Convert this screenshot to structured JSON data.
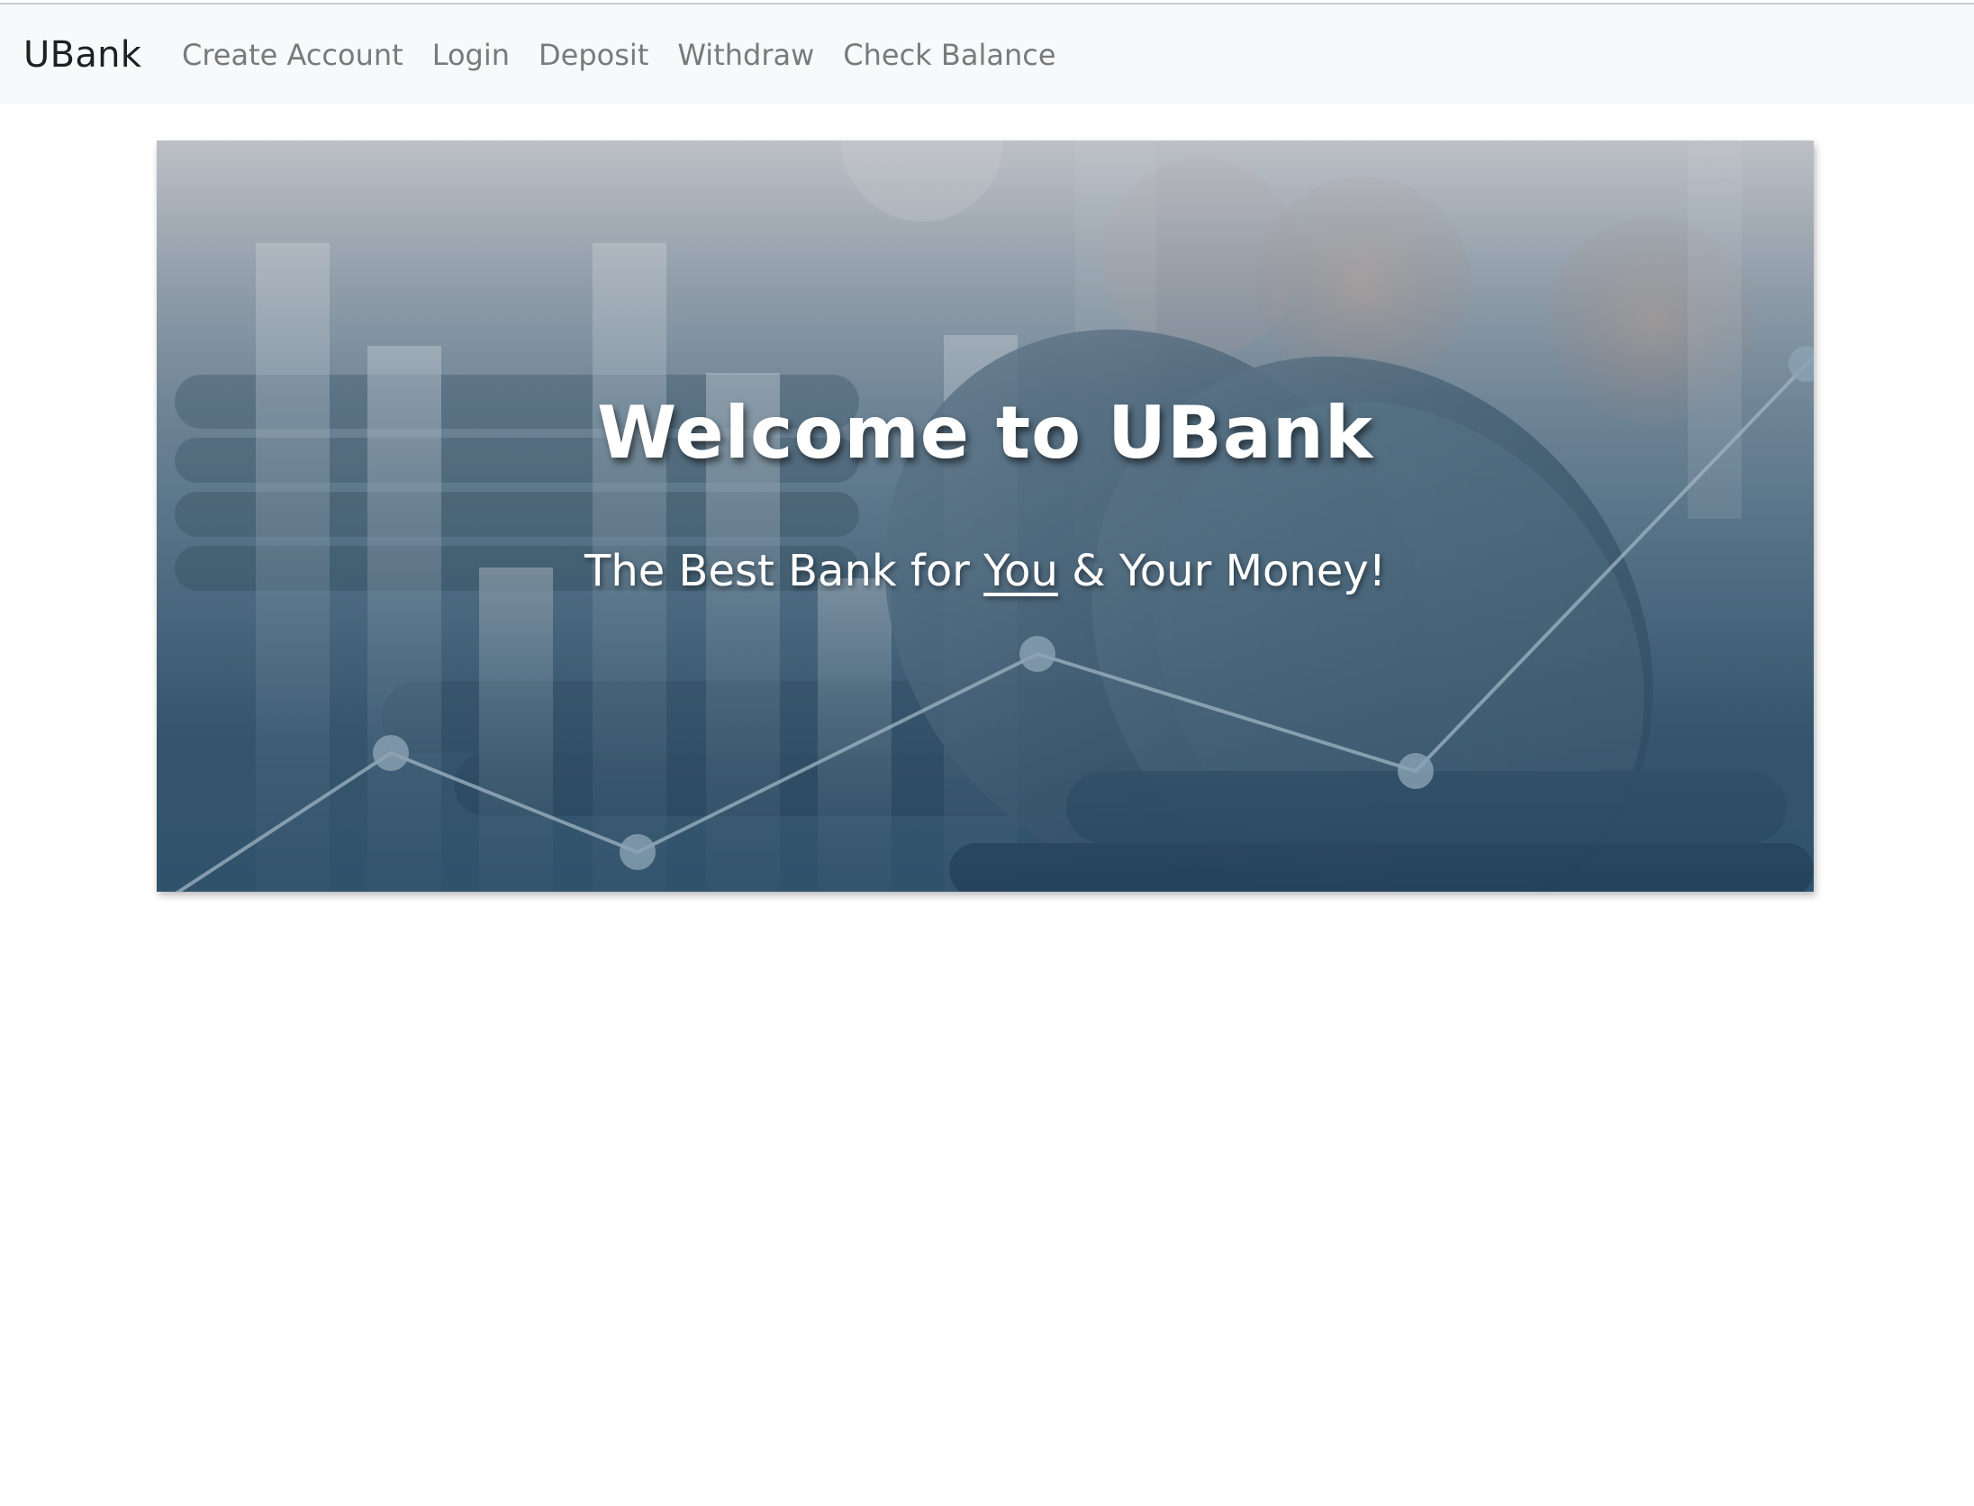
{
  "navbar": {
    "brand": "UBank",
    "links": [
      {
        "label": "Create Account"
      },
      {
        "label": "Login"
      },
      {
        "label": "Deposit"
      },
      {
        "label": "Withdraw"
      },
      {
        "label": "Check Balance"
      }
    ]
  },
  "hero": {
    "title": "Welcome to UBank",
    "subtitle_before": "The Best Bank for ",
    "subtitle_emphasis": "You",
    "subtitle_after": " & Your Money!",
    "background_image": "coins-and-financial-chart-icon"
  },
  "colors": {
    "navbar_bg": "#f8f9fa",
    "brand_text": "#1f2023",
    "nav_link_text": "#7a7a7a",
    "hero_text": "#ffffff",
    "hero_tint": "#3d6680"
  }
}
